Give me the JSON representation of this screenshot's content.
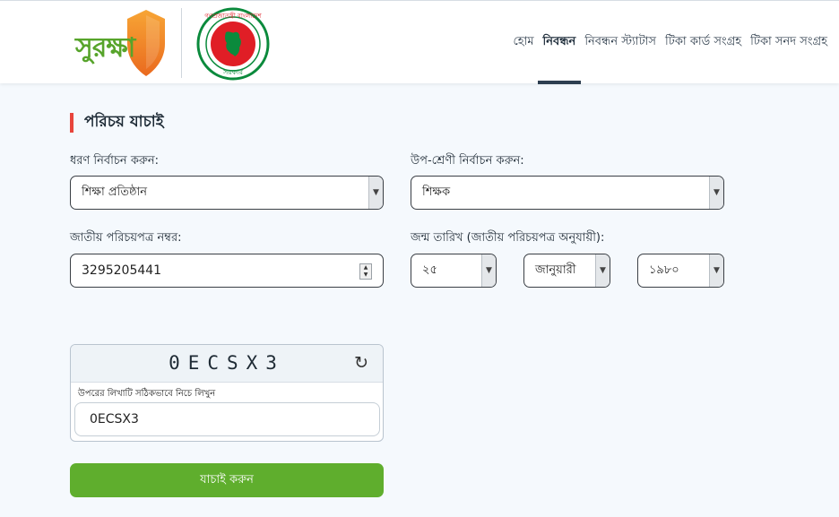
{
  "header": {
    "logo_text": "সুরক্ষা",
    "seal_text_top": "গণপ্রজাতন্ত্রী বাংলাদেশ",
    "seal_text_bottom": "সরকার",
    "nav": [
      {
        "label": "হোম",
        "active": false
      },
      {
        "label": "নিবন্ধন",
        "active": true
      },
      {
        "label": "নিবন্ধন স্ট্যাটাস",
        "active": false
      },
      {
        "label": "টিকা কার্ড সংগ্রহ",
        "active": false
      },
      {
        "label": "টিকা সনদ সংগ্রহ",
        "active": false
      }
    ]
  },
  "form": {
    "title": "পরিচয় যাচাই",
    "type_label": "ধরণ নির্বাচন করুন:",
    "type_value": "শিক্ষা প্রতিষ্ঠান",
    "subcategory_label": "উপ-শ্রেণী নির্বাচন করুন:",
    "subcategory_value": "শিক্ষক",
    "nid_label": "জাতীয় পরিচয়পত্র নম্বর:",
    "nid_value": "3295205441",
    "dob_label": "জন্ম তারিখ (জাতীয় পরিচয়পত্র অনুযায়ী):",
    "dob_day": "২৫",
    "dob_month": "জানুয়ারী",
    "dob_year": "১৯৮০"
  },
  "captcha": {
    "code": "0ECSX3",
    "hint": "উপরের লিখাটি সঠিকভাবে নিচে লিখুন",
    "input_value": "0ECSX3"
  },
  "submit_label": "যাচাই করুন",
  "colors": {
    "brand_green": "#5fae2d",
    "accent_red": "#e8453c",
    "nav_active": "#2d3e50"
  }
}
